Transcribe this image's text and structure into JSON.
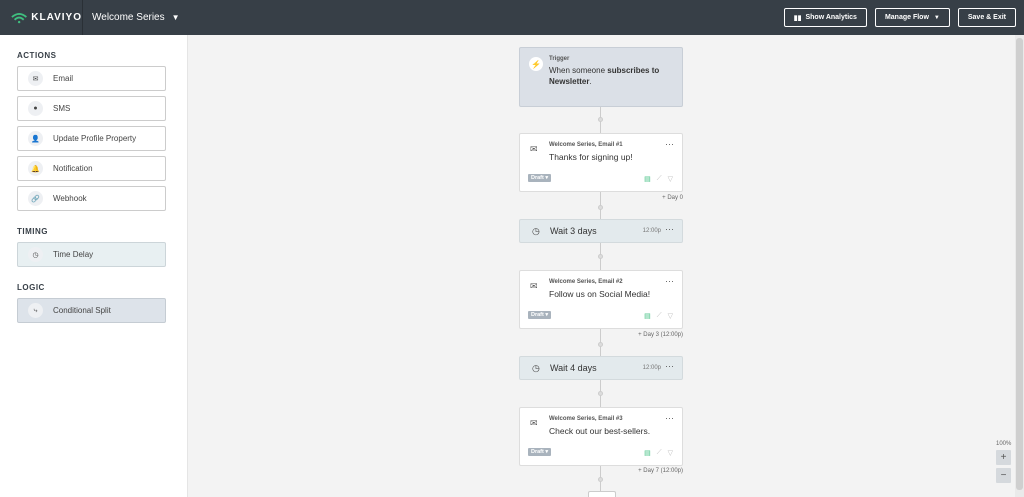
{
  "header": {
    "brand": "KLAVIYO",
    "flow_name": "Welcome Series",
    "show_analytics": "Show Analytics",
    "manage_flow": "Manage Flow",
    "save_exit": "Save & Exit"
  },
  "sidebar": {
    "actions_title": "ACTIONS",
    "actions": [
      {
        "label": "Email",
        "icon": "envelope-icon"
      },
      {
        "label": "SMS",
        "icon": "chat-bubble-icon"
      },
      {
        "label": "Update Profile Property",
        "icon": "person-icon"
      },
      {
        "label": "Notification",
        "icon": "bell-icon"
      },
      {
        "label": "Webhook",
        "icon": "link-icon"
      }
    ],
    "timing_title": "TIMING",
    "timing": [
      {
        "label": "Time Delay",
        "icon": "clock-icon"
      }
    ],
    "logic_title": "LOGIC",
    "logic": [
      {
        "label": "Conditional Split",
        "icon": "split-icon"
      }
    ]
  },
  "flow": {
    "trigger": {
      "label": "Trigger",
      "text_pre": "When someone ",
      "text_bold": "subscribes to Newsletter",
      "text_post": "."
    },
    "emails": [
      {
        "name": "Welcome Series, Email #1",
        "subject": "Thanks for signing up!",
        "status": "Draft",
        "day": "Day 0"
      },
      {
        "name": "Welcome Series, Email #2",
        "subject": "Follow us on Social Media!",
        "status": "Draft",
        "day": "Day 3 (12:00p)"
      },
      {
        "name": "Welcome Series, Email #3",
        "subject": "Check out our best-sellers.",
        "status": "Draft",
        "day": "Day 7 (12:00p)"
      }
    ],
    "waits": [
      {
        "text": "Wait 3 days",
        "time": "12:00p"
      },
      {
        "text": "Wait 4 days",
        "time": "12:00p"
      }
    ]
  },
  "zoom": {
    "level": "100%",
    "plus": "+",
    "minus": "−"
  },
  "colors": {
    "header_bg": "#373f47",
    "accent_green": "#3fbf7f",
    "trigger_bg": "#dbe0e7",
    "wait_bg": "#e3eaed"
  }
}
